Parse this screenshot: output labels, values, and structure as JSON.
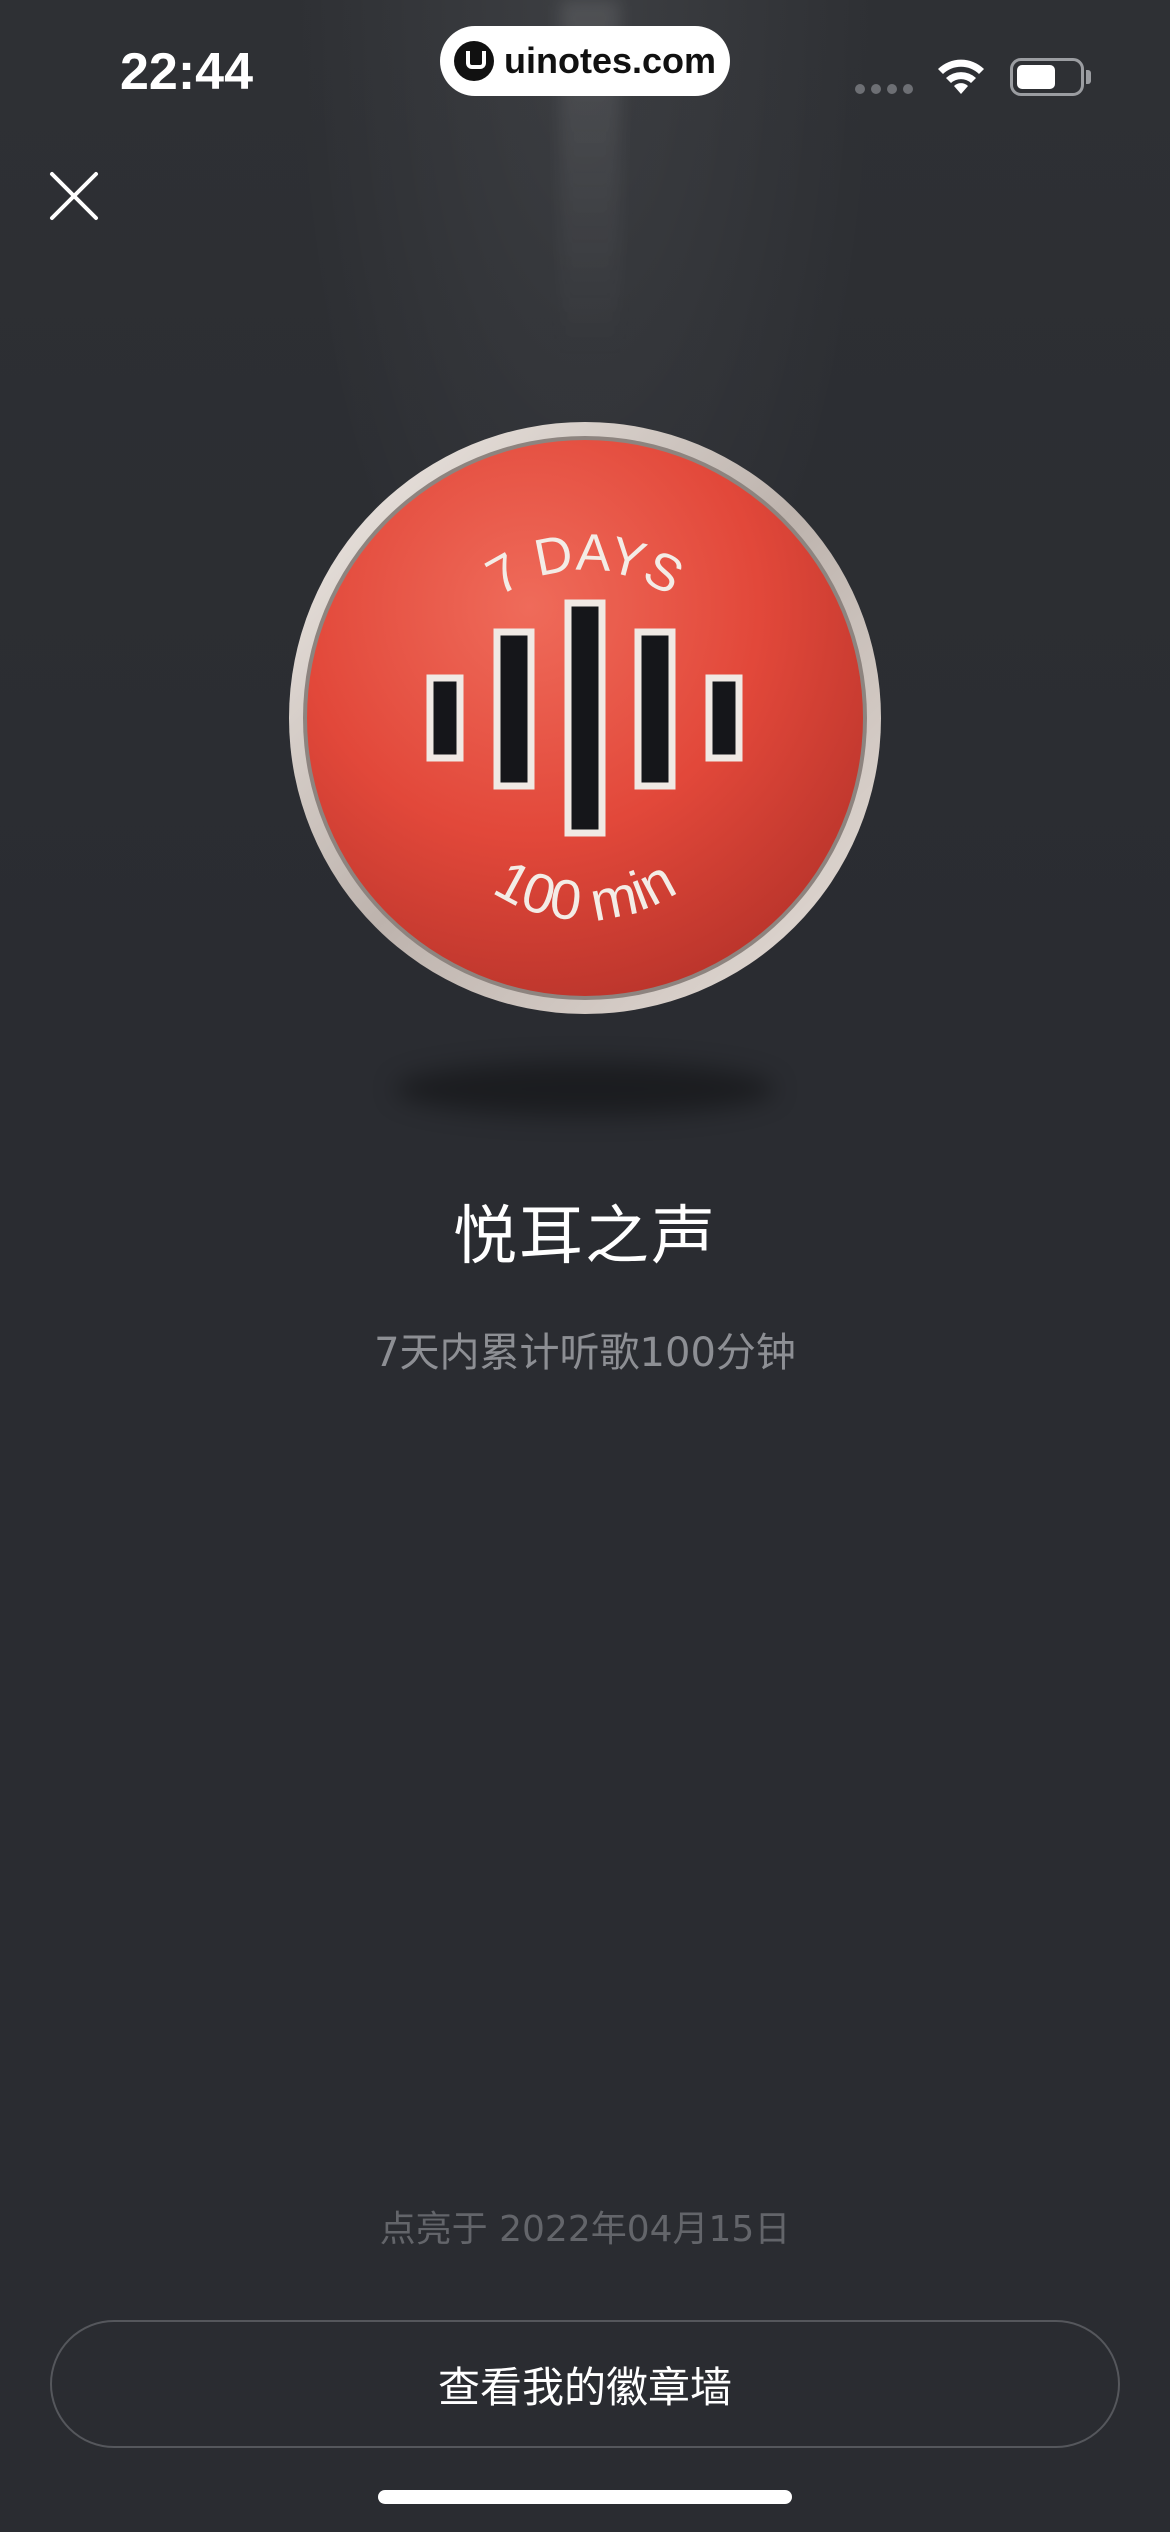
{
  "status_bar": {
    "time": "22:44",
    "url": "uinotes.com"
  },
  "badge": {
    "top_text": "7 DAYS",
    "bottom_text": "100 min",
    "title": "悦耳之声",
    "description": "7天内累计听歌100分钟",
    "lit_date": "点亮于 2022年04月15日"
  },
  "actions": {
    "view_wall_label": "查看我的徽章墙"
  },
  "icons": {
    "close": "close-icon",
    "wifi": "wifi-icon",
    "battery": "battery-icon",
    "signal": "signal-icon",
    "badge": "sound-wave-badge-icon"
  },
  "colors": {
    "background": "#2a2c31",
    "badge_red": "#e2493a",
    "badge_rim": "#d9d2cc",
    "text_primary": "#ffffff",
    "text_secondary": "#8d8f94"
  }
}
